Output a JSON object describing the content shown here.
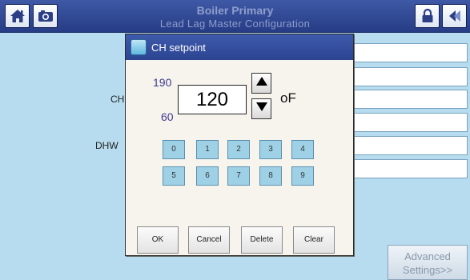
{
  "header": {
    "title": "Boiler Primary",
    "subtitle": "Lead Lag Master Configuration",
    "icons": [
      "home-icon",
      "camera-icon",
      "lock-icon",
      "back-icon"
    ]
  },
  "background": {
    "labels": {
      "ch": "CH",
      "dhw": "DHW"
    },
    "advanced_button": {
      "line1": "Advanced",
      "line2": "Settings>>"
    }
  },
  "dialog": {
    "title": "CH setpoint",
    "max": "190",
    "min": "60",
    "value": "120",
    "unit": "oF",
    "keypad": {
      "row1": [
        "0",
        "1",
        "2",
        "3",
        "4"
      ],
      "row2": [
        "5",
        "6",
        "7",
        "8",
        "9"
      ]
    },
    "buttons": {
      "ok": "OK",
      "cancel": "Cancel",
      "delete": "Delete",
      "clear": "Clear"
    }
  },
  "colors": {
    "header_bg": "#2f4a98",
    "background": "#b7dcef",
    "keypad": "#9fd1e6",
    "dialog_bg": "#f7f4ee"
  }
}
